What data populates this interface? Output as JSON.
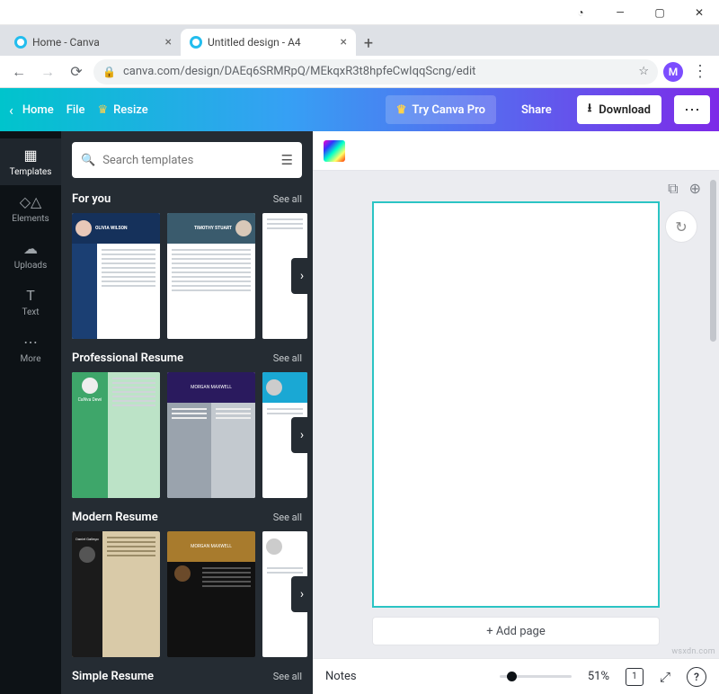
{
  "browser": {
    "tabs": [
      {
        "label": "Home - Canva"
      },
      {
        "label": "Untitled design - A4"
      }
    ],
    "url": "canva.com/design/DAEq6SRMRpQ/MEkqxR3t8hpfeCwIqqScng/edit",
    "avatar_initial": "M"
  },
  "topbar": {
    "home": "Home",
    "file": "File",
    "resize": "Resize",
    "try_pro": "Try Canva Pro",
    "share": "Share",
    "download": "Download"
  },
  "rail": {
    "templates": "Templates",
    "elements": "Elements",
    "uploads": "Uploads",
    "text": "Text",
    "more": "More"
  },
  "panel": {
    "search_placeholder": "Search templates",
    "sections": {
      "for_you": {
        "title": "For you",
        "see_all": "See all",
        "card1_name": "OLIVIA WILSON",
        "card2_name": "TIMOTHY STUART"
      },
      "professional": {
        "title": "Professional Resume",
        "see_all": "See all",
        "card1_name": "CaNva Dewi",
        "card2_name": "MORGAN MAXWELL"
      },
      "modern": {
        "title": "Modern Resume",
        "see_all": "See all",
        "card1_name": "Daniel Gallego",
        "card2_name": "MORGAN MAXWELL"
      },
      "simple": {
        "title": "Simple Resume",
        "see_all": "See all"
      }
    }
  },
  "canvas": {
    "add_page": "+ Add page"
  },
  "bottom": {
    "notes": "Notes",
    "zoom": "51%",
    "page_indicator": "1"
  }
}
